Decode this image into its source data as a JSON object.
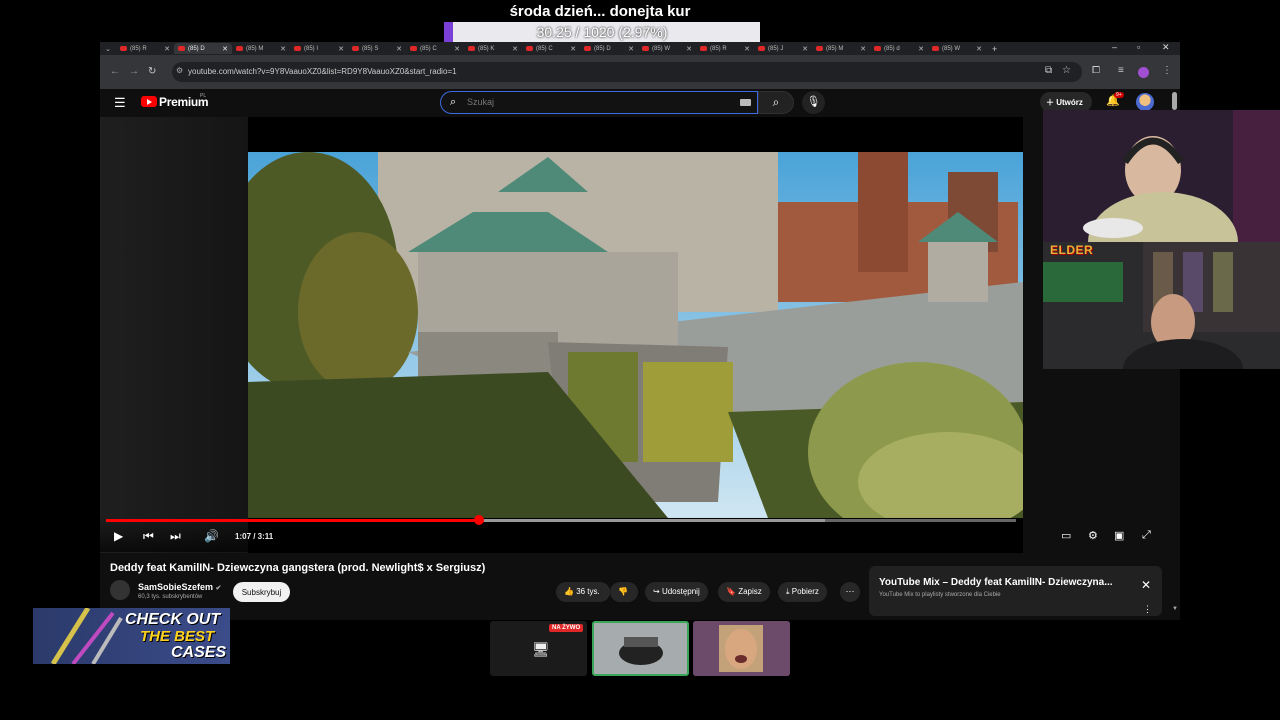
{
  "overlay": {
    "title": "środa dzień... donejta kur",
    "progress_text": "30.25 / 1020 (2.97%)",
    "progress_fraction": 0.0297
  },
  "browser": {
    "tabs": [
      {
        "label": "(85) R",
        "active": false
      },
      {
        "label": "(85) D",
        "active": true
      },
      {
        "label": "(85) M",
        "active": false
      },
      {
        "label": "(85) I",
        "active": false
      },
      {
        "label": "(85) S",
        "active": false
      },
      {
        "label": "(85) C",
        "active": false
      },
      {
        "label": "(85) K",
        "active": false
      },
      {
        "label": "(85) C",
        "active": false
      },
      {
        "label": "(85) D",
        "active": false
      },
      {
        "label": "(85) W",
        "active": false
      },
      {
        "label": "(85) R",
        "active": false
      },
      {
        "label": "(85) J",
        "active": false
      },
      {
        "label": "(85) M",
        "active": false
      },
      {
        "label": "(85) d",
        "active": false
      },
      {
        "label": "(85) W",
        "active": false
      }
    ],
    "url": "youtube.com/watch?v=9Y8VaauoXZ0&list=RD9Y8VaauoXZ0&start_radio=1"
  },
  "youtube": {
    "brand": "Premium",
    "country": "PL",
    "search_placeholder": "Szukaj",
    "create_label": "Utwórz",
    "notifications": "9+"
  },
  "player": {
    "time": "1:07 / 3:11",
    "played_fraction": 0.41,
    "buffered_fraction": 0.79
  },
  "video": {
    "title": "Deddy feat KamilIN- Dziewczyna gangstera (prod. Newlight$ x Sergiusz)",
    "channel": "SamSobieSzefem",
    "subscribers": "60,3 tys. subskrybentów",
    "subscribe_label": "Subskrybuj",
    "likes": "36 tys.",
    "share_label": "Udostępnij",
    "save_label": "Zapisz",
    "download_label": "Pobierz"
  },
  "mix": {
    "title": "YouTube Mix – Deddy feat KamilIN- Dziewczyna...",
    "subtitle": "YouTube Mix to playlisty stworzone dla Ciebie"
  },
  "stream": {
    "cam_tag": "ELDER",
    "live_badge": "NA ŻYWO",
    "promo": [
      "CHECK OUT",
      "THE BEST",
      "CASES"
    ]
  }
}
